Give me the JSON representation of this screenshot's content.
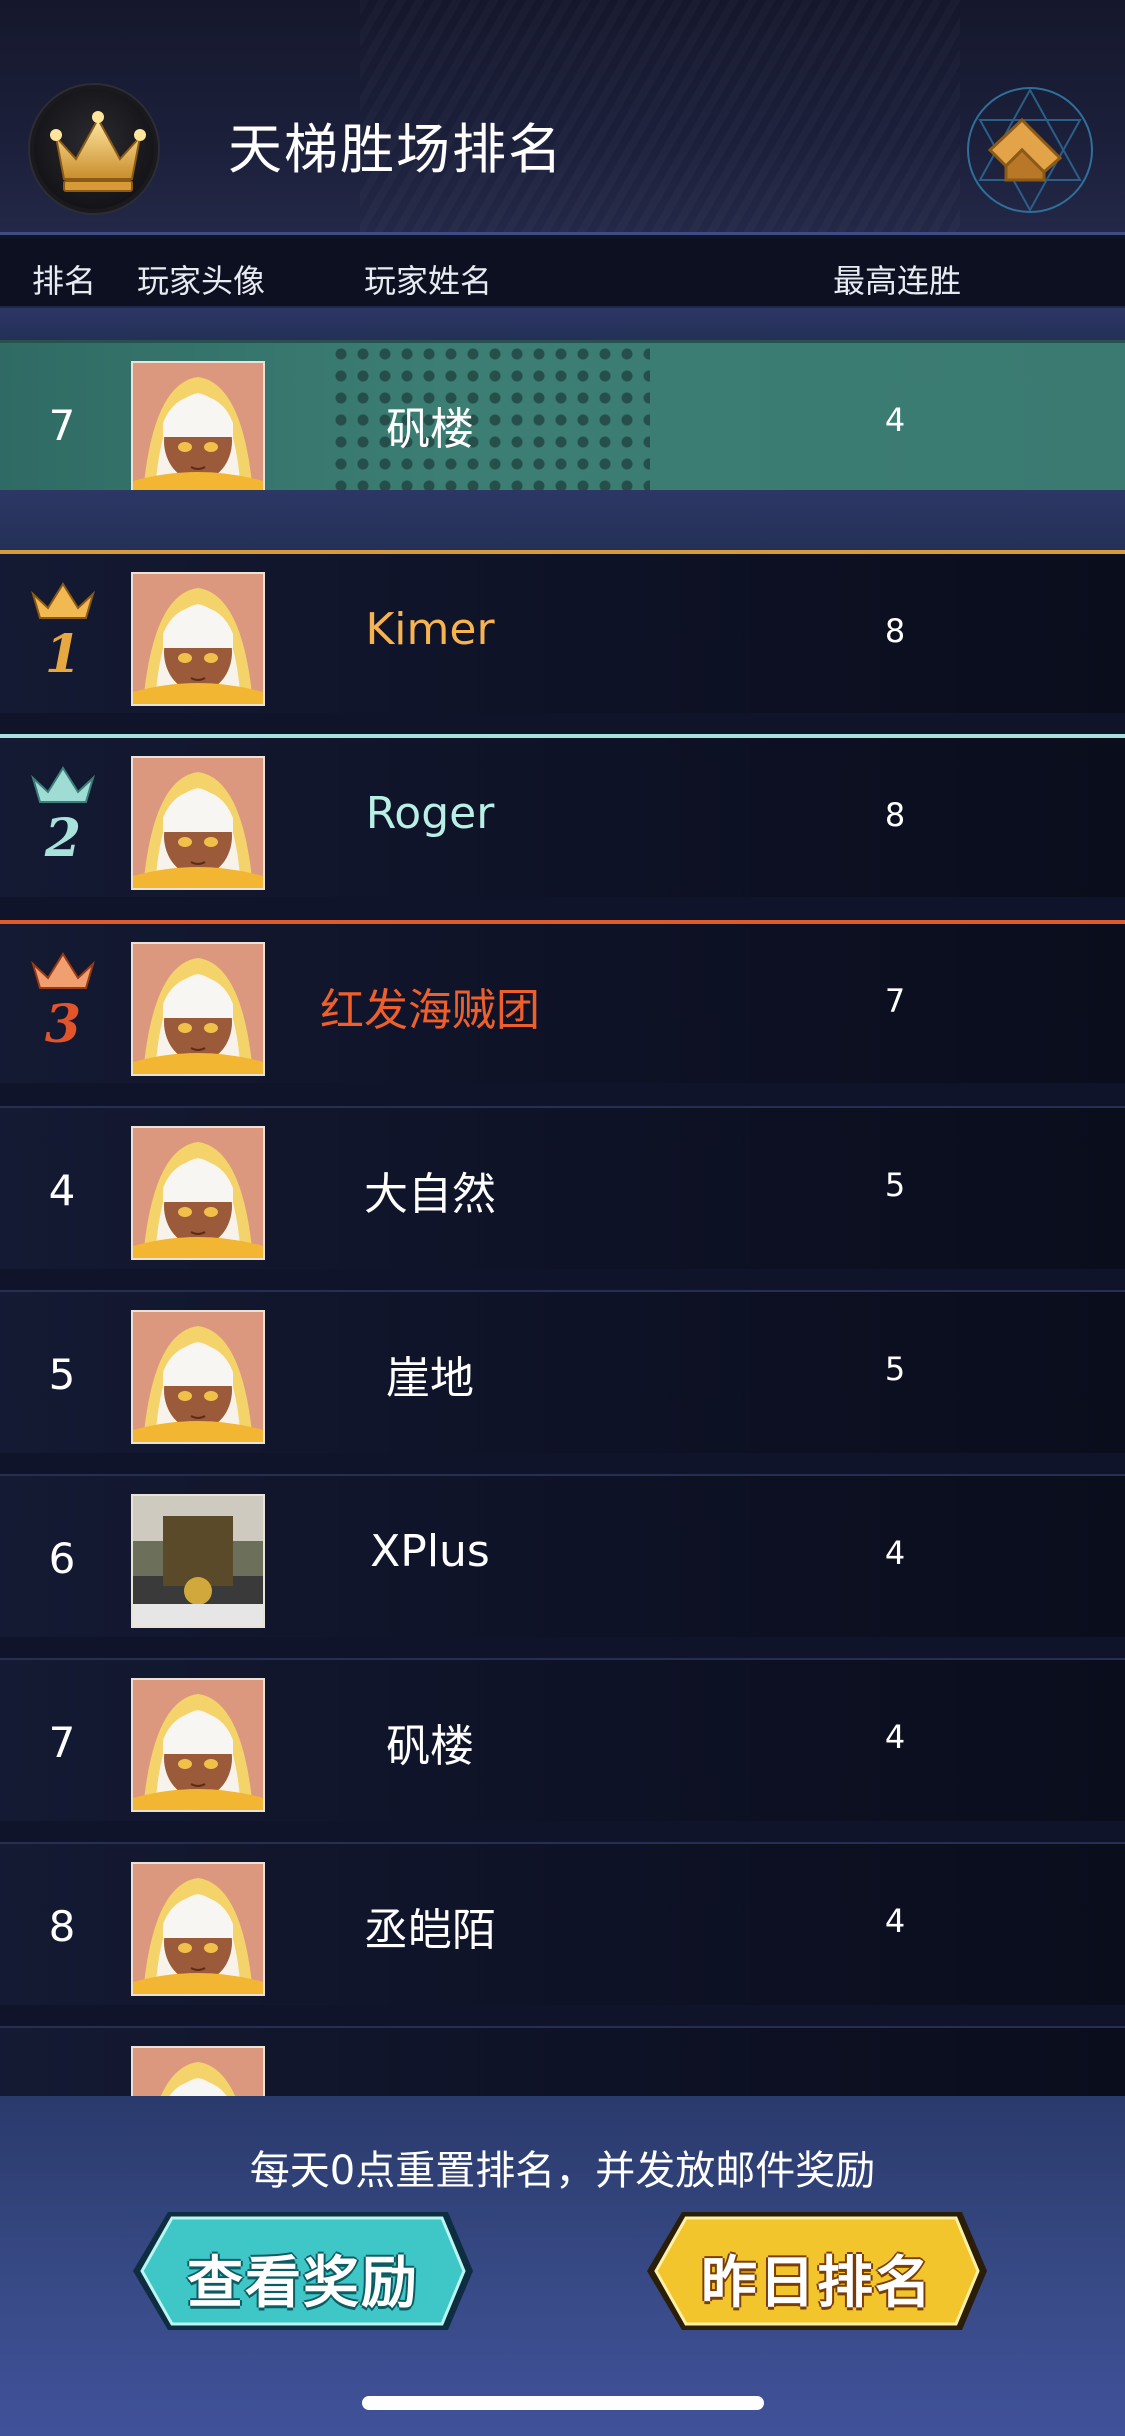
{
  "header": {
    "title": "天梯胜场排名",
    "crown_icon": "crown-icon",
    "back_icon": "back-arrow-icon"
  },
  "columns": {
    "rank": "排名",
    "avatar": "玩家头像",
    "name": "玩家姓名",
    "streak": "最高连胜"
  },
  "my_row": {
    "rank": "7",
    "name": "矾楼",
    "streak": "4"
  },
  "rows": [
    {
      "rank": "1",
      "name": "Kimer",
      "streak": "8"
    },
    {
      "rank": "2",
      "name": "Roger",
      "streak": "8"
    },
    {
      "rank": "3",
      "name": "红发海贼团",
      "streak": "7"
    },
    {
      "rank": "4",
      "name": "大自然",
      "streak": "5"
    },
    {
      "rank": "5",
      "name": "崖地",
      "streak": "5"
    },
    {
      "rank": "6",
      "name": "XPlus",
      "streak": "4"
    },
    {
      "rank": "7",
      "name": "矾楼",
      "streak": "4"
    },
    {
      "rank": "8",
      "name": "丞皑陌",
      "streak": "4"
    }
  ],
  "footer": {
    "notice": "每天0点重置排名，并发放邮件奖励",
    "view_rewards": "查看奖励",
    "yesterday_rank": "昨日排名"
  },
  "colors": {
    "gold": "#f6b34f",
    "silver": "#b9f0e6",
    "bronze": "#ee5f2c",
    "my_row": "#3a7a71"
  }
}
